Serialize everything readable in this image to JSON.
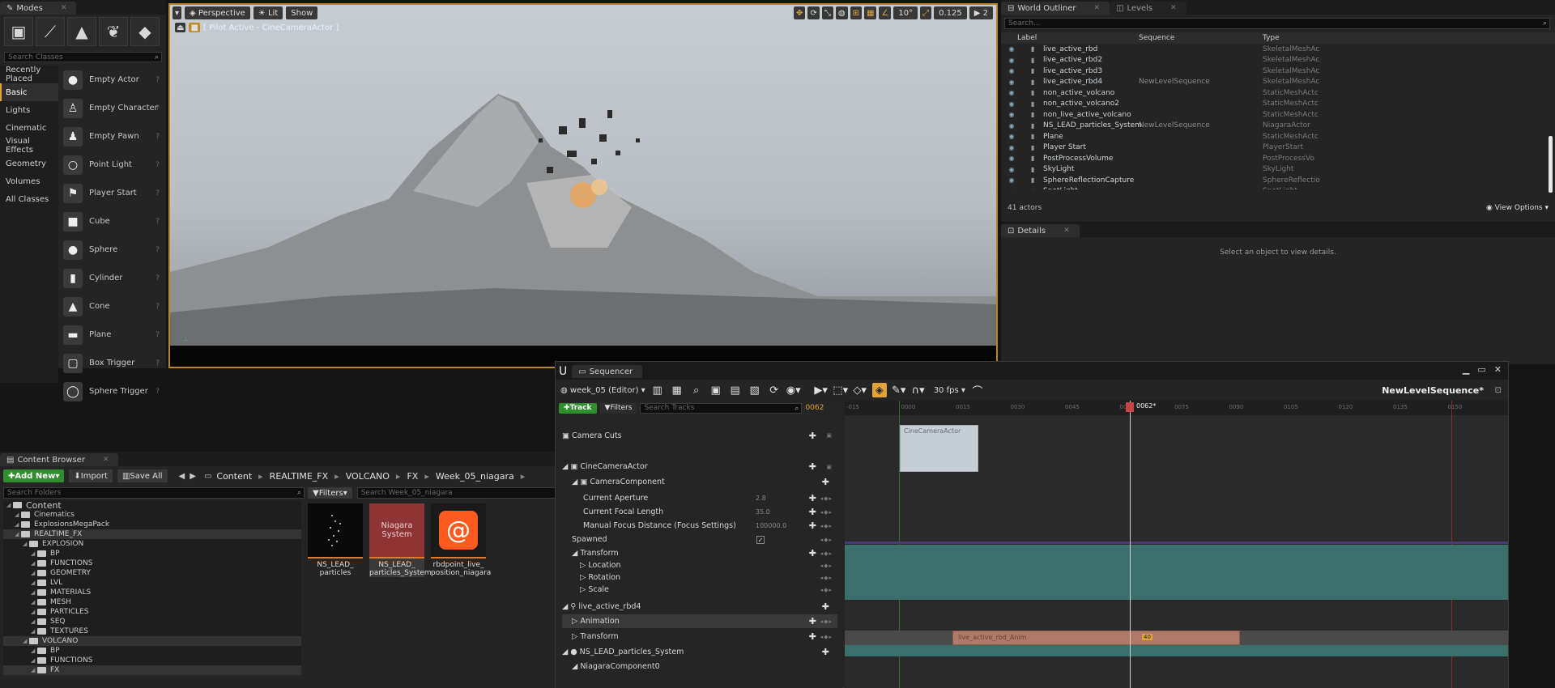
{
  "modes": {
    "tab": "Modes",
    "search_placeholder": "Search Classes",
    "categories": [
      "Recently Placed",
      "Basic",
      "Lights",
      "Cinematic",
      "Visual Effects",
      "Geometry",
      "Volumes",
      "All Classes"
    ],
    "items": [
      "Empty Actor",
      "Empty Character",
      "Empty Pawn",
      "Point Light",
      "Player Start",
      "Cube",
      "Sphere",
      "Cylinder",
      "Cone",
      "Plane",
      "Box Trigger",
      "Sphere Trigger"
    ]
  },
  "viewport": {
    "perspective": "Perspective",
    "lit": "Lit",
    "show": "Show",
    "pilot": "[ Pilot Active - CineCameraActor ]",
    "angle": "10°",
    "scale": "0.125",
    "cams": "2"
  },
  "outliner": {
    "tab": "World Outliner",
    "levels_tab": "Levels",
    "search_placeholder": "Search...",
    "col_label": "Label",
    "col_sequence": "Sequence",
    "col_type": "Type",
    "rows": [
      {
        "label": "live_active_rbd",
        "seq": "",
        "type": "SkeletalMeshAc"
      },
      {
        "label": "live_active_rbd2",
        "seq": "",
        "type": "SkeletalMeshAc"
      },
      {
        "label": "live_active_rbd3",
        "seq": "",
        "type": "SkeletalMeshAc"
      },
      {
        "label": "live_active_rbd4",
        "seq": "NewLevelSequence",
        "type": "SkeletalMeshAc"
      },
      {
        "label": "non_active_volcano",
        "seq": "",
        "type": "StaticMeshActc"
      },
      {
        "label": "non_active_volcano2",
        "seq": "",
        "type": "StaticMeshActc"
      },
      {
        "label": "non_live_active_volcano",
        "seq": "",
        "type": "StaticMeshActc"
      },
      {
        "label": "NS_LEAD_particles_System",
        "seq": "NewLevelSequence",
        "type": "NiagaraActor"
      },
      {
        "label": "Plane",
        "seq": "",
        "type": "StaticMeshActc"
      },
      {
        "label": "Player Start",
        "seq": "",
        "type": "PlayerStart"
      },
      {
        "label": "PostProcessVolume",
        "seq": "",
        "type": "PostProcessVo"
      },
      {
        "label": "SkyLight",
        "seq": "",
        "type": "SkyLight"
      },
      {
        "label": "SphereReflectionCapture",
        "seq": "",
        "type": "SphereReflectio"
      },
      {
        "label": "SpotLight",
        "seq": "",
        "type": "SpotLight"
      }
    ],
    "count": "41 actors",
    "view_options": "View Options"
  },
  "details": {
    "tab": "Details",
    "empty": "Select an object to view details."
  },
  "content_browser": {
    "tab": "Content Browser",
    "add_new": "Add New",
    "import": "Import",
    "save_all": "Save All",
    "path": [
      "Content",
      "REALTIME_FX",
      "VOLCANO",
      "FX",
      "Week_05_niagara"
    ],
    "folders_placeholder": "Search Folders",
    "filters": "Filters",
    "assets_placeholder": "Search Week_05_niagara",
    "tree": [
      {
        "name": "Content",
        "depth": 0
      },
      {
        "name": "Cinematics",
        "depth": 1
      },
      {
        "name": "ExplosionsMegaPack",
        "depth": 1
      },
      {
        "name": "REALTIME_FX",
        "depth": 1
      },
      {
        "name": "EXPLOSION",
        "depth": 2
      },
      {
        "name": "BP",
        "depth": 3
      },
      {
        "name": "FUNCTIONS",
        "depth": 3
      },
      {
        "name": "GEOMETRY",
        "depth": 3
      },
      {
        "name": "LVL",
        "depth": 3
      },
      {
        "name": "MATERIALS",
        "depth": 3
      },
      {
        "name": "MESH",
        "depth": 3
      },
      {
        "name": "PARTICLES",
        "depth": 3
      },
      {
        "name": "SEQ",
        "depth": 3
      },
      {
        "name": "TEXTURES",
        "depth": 3
      },
      {
        "name": "VOLCANO",
        "depth": 2
      },
      {
        "name": "BP",
        "depth": 3
      },
      {
        "name": "FUNCTIONS",
        "depth": 3
      },
      {
        "name": "FX",
        "depth": 3
      }
    ],
    "assets": [
      {
        "label": "NS_LEAD_ particles"
      },
      {
        "label": "NS_LEAD_ particles_System",
        "thumb": "Niagara System"
      },
      {
        "label": "rbdpoint_live_ position_niagara"
      }
    ]
  },
  "sequencer": {
    "tab": "Sequencer",
    "world": "week_05 (Editor)",
    "fps": "30 fps",
    "sequence_name": "NewLevelSequence*",
    "track_btn": "Track",
    "filters_btn": "Filters",
    "search_placeholder": "Search Tracks",
    "current_frame": "0062",
    "playhead_label": "0062*",
    "ticks": [
      "-015",
      "0000",
      "0015",
      "0030",
      "0045",
      "0060",
      "0075",
      "0090",
      "0105",
      "0120",
      "0135",
      "0150"
    ],
    "tracks": {
      "camera_cuts": "Camera Cuts",
      "cine_actor": "CineCameraActor",
      "camera_component": "CameraComponent",
      "aperture": "Current Aperture",
      "aperture_val": "2.8",
      "focal": "Current Focal Length",
      "focal_val": "35.0",
      "focus": "Manual Focus Distance (Focus Settings)",
      "focus_val": "100000.0",
      "spawned": "Spawned",
      "transform": "Transform",
      "location": "Location",
      "rotation": "Rotation",
      "scale": "Scale",
      "rbd4": "live_active_rbd4",
      "animation": "Animation",
      "transform2": "Transform",
      "ns_lead": "NS_LEAD_particles_System",
      "niagara_comp": "NiagaraComponent0"
    },
    "section_camera": "CineCameraActor",
    "section_anim": "live_active_rbd_Anim",
    "section_anim_badge": "40"
  },
  "colors": {
    "accent": "#e2a33a",
    "transform_band": "#3a6f6c",
    "anim_section": "#b07a6b"
  }
}
